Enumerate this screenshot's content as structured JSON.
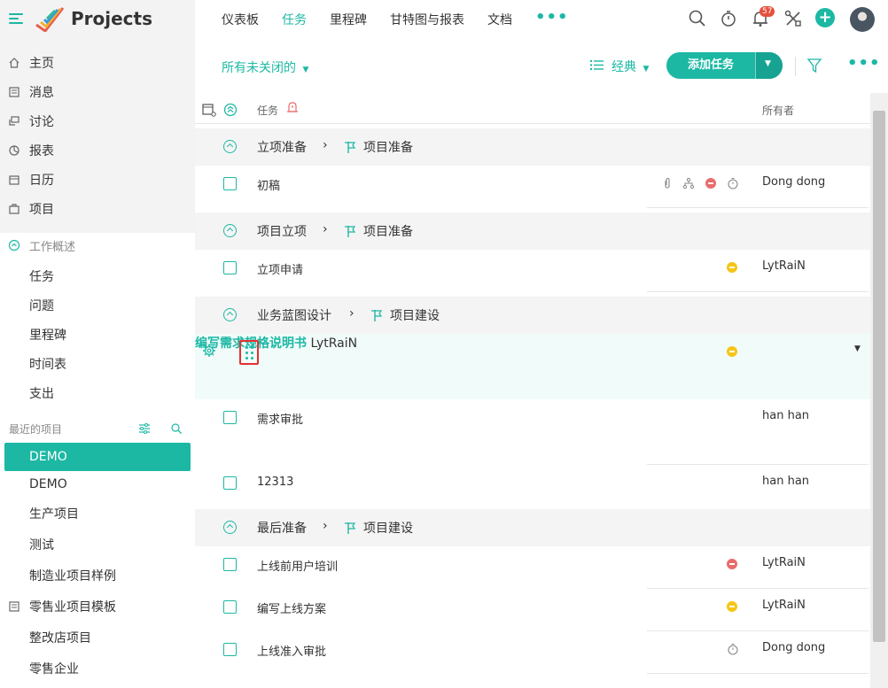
{
  "app": {
    "name": "Projects"
  },
  "nav": {
    "items": [
      "仪表板",
      "任务",
      "里程碑",
      "甘特图与报表",
      "文档"
    ],
    "active_index": 1,
    "more": "•••"
  },
  "notifications": {
    "count": "57"
  },
  "sidebar": {
    "main": [
      "主页",
      "消息",
      "讨论",
      "报表",
      "日历",
      "项目"
    ],
    "work_overview": "工作概述",
    "work_items": [
      "任务",
      "问题",
      "里程碑",
      "时间表",
      "支出"
    ],
    "recent_label": "最近的项目",
    "projects": [
      "DEMO",
      "DEMO",
      "生产项目",
      "测试",
      "制造业项目样例",
      "零售业项目模板",
      "整改店项目",
      "零售企业"
    ]
  },
  "toolbar": {
    "filter": "所有未关闭的",
    "view": "经典",
    "add_task": "添加任务"
  },
  "columns": {
    "task": "任务",
    "owner": "所有者"
  },
  "groups": [
    {
      "name": "立项准备",
      "parent": "项目准备"
    },
    {
      "name": "项目立项",
      "parent": "项目准备"
    },
    {
      "name": "业务蓝图设计",
      "parent": "项目建设"
    },
    {
      "name": "最后准备",
      "parent": "项目建设"
    }
  ],
  "tasks": [
    {
      "name": "初稿",
      "owner": "Dong dong"
    },
    {
      "name": "立项申请",
      "owner": "LytRaiN",
      "status": "yellow"
    },
    {
      "name": "编写需求规格说明书",
      "owner": "LytRaiN",
      "status": "yellow"
    },
    {
      "name": "需求审批",
      "owner": "han han"
    },
    {
      "name": "12313",
      "owner": "han han"
    },
    {
      "name": "上线前用户培训",
      "owner": "LytRaiN",
      "status": "red"
    },
    {
      "name": "编写上线方案",
      "owner": "LytRaiN",
      "status": "yellow"
    },
    {
      "name": "上线准入审批",
      "owner": "Dong dong",
      "status": "timer"
    }
  ],
  "colors": {
    "accent": "#1cb8a4",
    "warning": "#f5c518",
    "danger": "#e86c6c",
    "highlight": "#e53030"
  }
}
